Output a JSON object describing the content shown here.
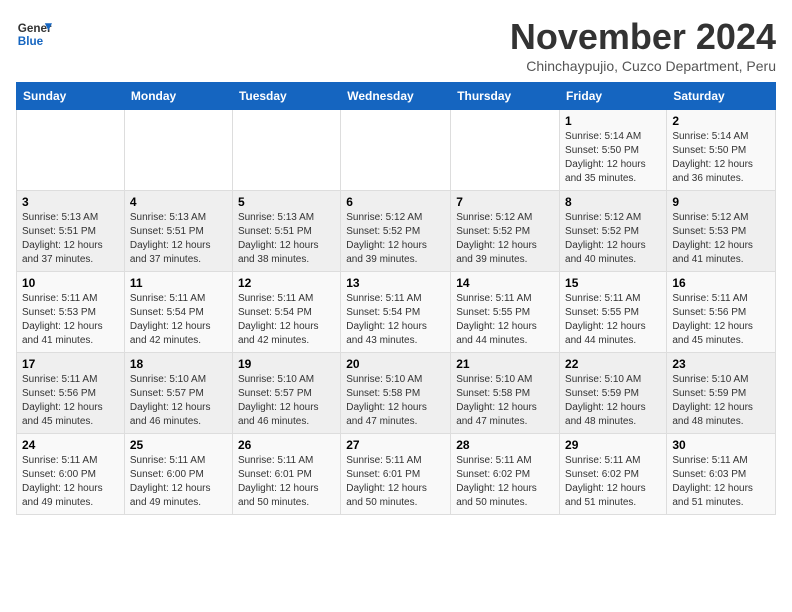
{
  "logo": {
    "line1": "General",
    "line2": "Blue"
  },
  "title": "November 2024",
  "location": "Chinchaypujio, Cuzco Department, Peru",
  "days_of_week": [
    "Sunday",
    "Monday",
    "Tuesday",
    "Wednesday",
    "Thursday",
    "Friday",
    "Saturday"
  ],
  "weeks": [
    [
      {
        "day": "",
        "info": ""
      },
      {
        "day": "",
        "info": ""
      },
      {
        "day": "",
        "info": ""
      },
      {
        "day": "",
        "info": ""
      },
      {
        "day": "",
        "info": ""
      },
      {
        "day": "1",
        "info": "Sunrise: 5:14 AM\nSunset: 5:50 PM\nDaylight: 12 hours\nand 35 minutes."
      },
      {
        "day": "2",
        "info": "Sunrise: 5:14 AM\nSunset: 5:50 PM\nDaylight: 12 hours\nand 36 minutes."
      }
    ],
    [
      {
        "day": "3",
        "info": "Sunrise: 5:13 AM\nSunset: 5:51 PM\nDaylight: 12 hours\nand 37 minutes."
      },
      {
        "day": "4",
        "info": "Sunrise: 5:13 AM\nSunset: 5:51 PM\nDaylight: 12 hours\nand 37 minutes."
      },
      {
        "day": "5",
        "info": "Sunrise: 5:13 AM\nSunset: 5:51 PM\nDaylight: 12 hours\nand 38 minutes."
      },
      {
        "day": "6",
        "info": "Sunrise: 5:12 AM\nSunset: 5:52 PM\nDaylight: 12 hours\nand 39 minutes."
      },
      {
        "day": "7",
        "info": "Sunrise: 5:12 AM\nSunset: 5:52 PM\nDaylight: 12 hours\nand 39 minutes."
      },
      {
        "day": "8",
        "info": "Sunrise: 5:12 AM\nSunset: 5:52 PM\nDaylight: 12 hours\nand 40 minutes."
      },
      {
        "day": "9",
        "info": "Sunrise: 5:12 AM\nSunset: 5:53 PM\nDaylight: 12 hours\nand 41 minutes."
      }
    ],
    [
      {
        "day": "10",
        "info": "Sunrise: 5:11 AM\nSunset: 5:53 PM\nDaylight: 12 hours\nand 41 minutes."
      },
      {
        "day": "11",
        "info": "Sunrise: 5:11 AM\nSunset: 5:54 PM\nDaylight: 12 hours\nand 42 minutes."
      },
      {
        "day": "12",
        "info": "Sunrise: 5:11 AM\nSunset: 5:54 PM\nDaylight: 12 hours\nand 42 minutes."
      },
      {
        "day": "13",
        "info": "Sunrise: 5:11 AM\nSunset: 5:54 PM\nDaylight: 12 hours\nand 43 minutes."
      },
      {
        "day": "14",
        "info": "Sunrise: 5:11 AM\nSunset: 5:55 PM\nDaylight: 12 hours\nand 44 minutes."
      },
      {
        "day": "15",
        "info": "Sunrise: 5:11 AM\nSunset: 5:55 PM\nDaylight: 12 hours\nand 44 minutes."
      },
      {
        "day": "16",
        "info": "Sunrise: 5:11 AM\nSunset: 5:56 PM\nDaylight: 12 hours\nand 45 minutes."
      }
    ],
    [
      {
        "day": "17",
        "info": "Sunrise: 5:11 AM\nSunset: 5:56 PM\nDaylight: 12 hours\nand 45 minutes."
      },
      {
        "day": "18",
        "info": "Sunrise: 5:10 AM\nSunset: 5:57 PM\nDaylight: 12 hours\nand 46 minutes."
      },
      {
        "day": "19",
        "info": "Sunrise: 5:10 AM\nSunset: 5:57 PM\nDaylight: 12 hours\nand 46 minutes."
      },
      {
        "day": "20",
        "info": "Sunrise: 5:10 AM\nSunset: 5:58 PM\nDaylight: 12 hours\nand 47 minutes."
      },
      {
        "day": "21",
        "info": "Sunrise: 5:10 AM\nSunset: 5:58 PM\nDaylight: 12 hours\nand 47 minutes."
      },
      {
        "day": "22",
        "info": "Sunrise: 5:10 AM\nSunset: 5:59 PM\nDaylight: 12 hours\nand 48 minutes."
      },
      {
        "day": "23",
        "info": "Sunrise: 5:10 AM\nSunset: 5:59 PM\nDaylight: 12 hours\nand 48 minutes."
      }
    ],
    [
      {
        "day": "24",
        "info": "Sunrise: 5:11 AM\nSunset: 6:00 PM\nDaylight: 12 hours\nand 49 minutes."
      },
      {
        "day": "25",
        "info": "Sunrise: 5:11 AM\nSunset: 6:00 PM\nDaylight: 12 hours\nand 49 minutes."
      },
      {
        "day": "26",
        "info": "Sunrise: 5:11 AM\nSunset: 6:01 PM\nDaylight: 12 hours\nand 50 minutes."
      },
      {
        "day": "27",
        "info": "Sunrise: 5:11 AM\nSunset: 6:01 PM\nDaylight: 12 hours\nand 50 minutes."
      },
      {
        "day": "28",
        "info": "Sunrise: 5:11 AM\nSunset: 6:02 PM\nDaylight: 12 hours\nand 50 minutes."
      },
      {
        "day": "29",
        "info": "Sunrise: 5:11 AM\nSunset: 6:02 PM\nDaylight: 12 hours\nand 51 minutes."
      },
      {
        "day": "30",
        "info": "Sunrise: 5:11 AM\nSunset: 6:03 PM\nDaylight: 12 hours\nand 51 minutes."
      }
    ]
  ]
}
